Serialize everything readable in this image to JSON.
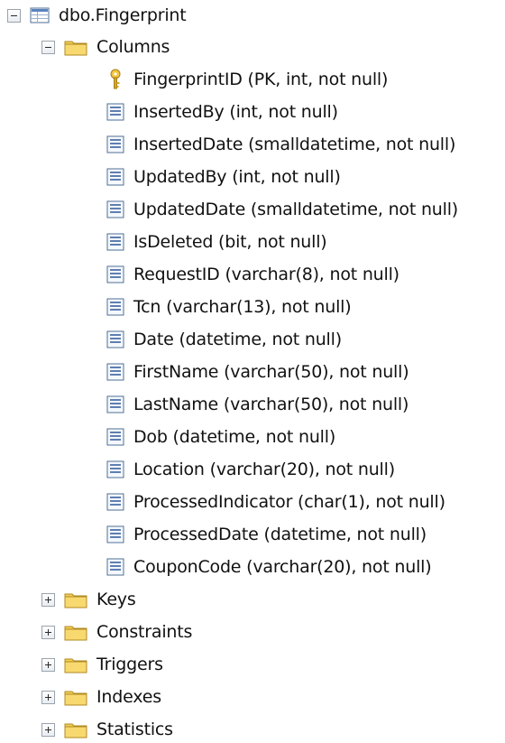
{
  "tree": {
    "table": {
      "label": "dbo.Fingerprint",
      "icon": "table-icon"
    },
    "columns_folder": {
      "label": "Columns",
      "icon": "folder-icon",
      "expanded": true
    },
    "columns": [
      {
        "label": "FingerprintID (PK, int, not null)",
        "icon": "key-icon"
      },
      {
        "label": "InsertedBy (int, not null)",
        "icon": "column-icon"
      },
      {
        "label": "InsertedDate (smalldatetime, not null)",
        "icon": "column-icon"
      },
      {
        "label": "UpdatedBy (int, not null)",
        "icon": "column-icon"
      },
      {
        "label": "UpdatedDate (smalldatetime, not null)",
        "icon": "column-icon"
      },
      {
        "label": "IsDeleted (bit, not null)",
        "icon": "column-icon"
      },
      {
        "label": "RequestID (varchar(8), not null)",
        "icon": "column-icon"
      },
      {
        "label": "Tcn (varchar(13), not null)",
        "icon": "column-icon"
      },
      {
        "label": "Date (datetime, not null)",
        "icon": "column-icon"
      },
      {
        "label": "FirstName (varchar(50), not null)",
        "icon": "column-icon"
      },
      {
        "label": "LastName (varchar(50), not null)",
        "icon": "column-icon"
      },
      {
        "label": "Dob (datetime, not null)",
        "icon": "column-icon"
      },
      {
        "label": "Location (varchar(20), not null)",
        "icon": "column-icon"
      },
      {
        "label": "ProcessedIndicator (char(1), not null)",
        "icon": "column-icon"
      },
      {
        "label": "ProcessedDate (datetime, not null)",
        "icon": "column-icon"
      },
      {
        "label": "CouponCode (varchar(20), not null)",
        "icon": "column-icon"
      }
    ],
    "folders": [
      {
        "label": "Keys",
        "icon": "folder-icon",
        "expanded": false
      },
      {
        "label": "Constraints",
        "icon": "folder-icon",
        "expanded": false
      },
      {
        "label": "Triggers",
        "icon": "folder-icon",
        "expanded": false
      },
      {
        "label": "Indexes",
        "icon": "folder-icon",
        "expanded": false
      },
      {
        "label": "Statistics",
        "icon": "folder-icon",
        "expanded": false
      }
    ]
  }
}
